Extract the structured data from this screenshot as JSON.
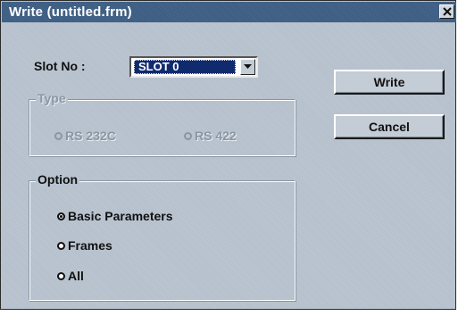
{
  "window": {
    "title": "Write (untitled.frm)",
    "close_glyph": "×"
  },
  "slot": {
    "label": "Slot No :",
    "selected": "SLOT 0"
  },
  "type_group": {
    "legend": "Type",
    "options": [
      {
        "label": "RS 232C",
        "checked": false,
        "enabled": false
      },
      {
        "label": "RS 422",
        "checked": false,
        "enabled": false
      }
    ]
  },
  "option_group": {
    "legend": "Option",
    "options": [
      {
        "label": "Basic Parameters",
        "checked": true
      },
      {
        "label": "Frames",
        "checked": false
      },
      {
        "label": "All",
        "checked": false
      }
    ]
  },
  "buttons": {
    "write_label": "Write",
    "cancel_label": "Cancel"
  },
  "colors": {
    "titlebar": "#3d5f86",
    "dialog_bg": "#b8c3cf",
    "selection": "#102a6e"
  }
}
